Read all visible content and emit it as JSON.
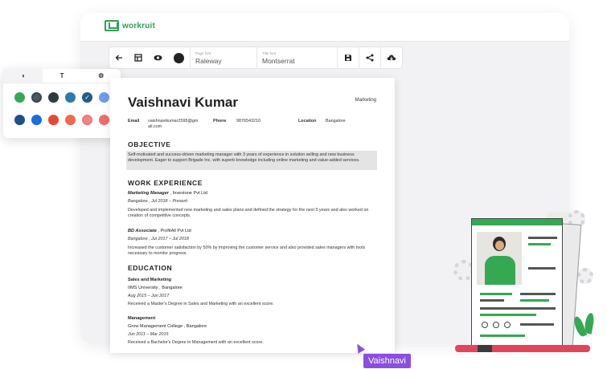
{
  "app": {
    "logo_text": "workruit",
    "brand_color": "#2f9e57"
  },
  "toolbar": {
    "back_icon": "arrow-left-icon",
    "layout_icon": "layout-icon",
    "preview_icon": "eye-icon",
    "color_icon": "color-dot-icon",
    "page_font": {
      "label": "Page font",
      "value": "Raleway"
    },
    "title_font": {
      "label": "Title font",
      "value": "Montserrat"
    },
    "save_icon": "save-icon",
    "share_icon": "share-icon",
    "download_icon": "cloud-download-icon"
  },
  "panel": {
    "tabs": [
      {
        "icon": "contrast-icon",
        "glyph": "◑"
      },
      {
        "icon": "text-icon",
        "glyph": "T"
      },
      {
        "icon": "settings-icon",
        "glyph": "⚙"
      }
    ],
    "swatches_row1": [
      {
        "color": "#36a857",
        "dotted": false,
        "selected": false
      },
      {
        "color": "#37474f",
        "dotted": true,
        "selected": false
      },
      {
        "color": "#2e3a40",
        "dotted": false,
        "selected": false
      },
      {
        "color": "#2a7ab0",
        "dotted": false,
        "selected": false
      },
      {
        "color": "#1d5b8a",
        "dotted": false,
        "selected": true
      },
      {
        "color": "#6f9cf0",
        "dotted": false,
        "selected": false
      }
    ],
    "swatches_row2": [
      {
        "color": "#1f4e8c",
        "dotted": false,
        "selected": false
      },
      {
        "color": "#1a6fe0",
        "dotted": false,
        "selected": false
      },
      {
        "color": "#e64a2e",
        "dotted": false,
        "selected": false
      },
      {
        "color": "#ef6a4a",
        "dotted": false,
        "selected": false
      },
      {
        "color": "#f07878",
        "dotted": true,
        "selected": false
      },
      {
        "color": "#f26b6b",
        "dotted": false,
        "selected": false
      }
    ]
  },
  "resume": {
    "name": "Vaishnavi Kumar",
    "role": "Marketing",
    "email_label": "Email",
    "email_line1": "vaishnavikumar2595@gm",
    "email_line2": "ail.com",
    "phone_label": "Phone",
    "phone": "9876543210",
    "location_label": "Location",
    "location": "Bangalore",
    "objective_title": "OBJECTIVE",
    "objective_text": "Self-motivated and success-driven marketing manager with 3 years of experience in solution selling and new business development. Eager to support Brigade Inc. with superb knowledge including online marketing and value-added services.",
    "work_title": "WORK EXPERIENCE",
    "jobs": [
      {
        "title": "Marketing Manager",
        "company": "Investone Pvt Ltd",
        "meta": "Bangalore ,   Jul 2018   –   Present",
        "desc": "Developed and implemented new marketing and sales plans and defined the strategy for the next 5 years and also worked on creation of competitive concepts."
      },
      {
        "title": "BD Associate",
        "company": "ProfitAll Pvt Ltd",
        "meta": "Bangalore ,   Jul 2017   –   Jul 2018",
        "desc": "Increased the customer satisfaction by 50% by improving the customer service and also provided sales managers with tools necessary to monitor progress."
      }
    ],
    "education_title": "EDUCATION",
    "education": [
      {
        "degree": "Sales and Marketing",
        "school": "IIMS University ,   Bangalore",
        "dates": "Aug 2015   –   Jun 2017",
        "desc": "Received a Master's Degree in Sales and Marketing with an excellent score."
      },
      {
        "degree": "Management",
        "school": "Grow Management College ,   Bangalore",
        "dates": "Jun 2011   –   Mar 2015",
        "desc": "Received a Bachelor's Degree in Management with an excellent score."
      }
    ]
  },
  "cursor": {
    "name": "Vaishnavi",
    "color": "#8a4fe0"
  }
}
